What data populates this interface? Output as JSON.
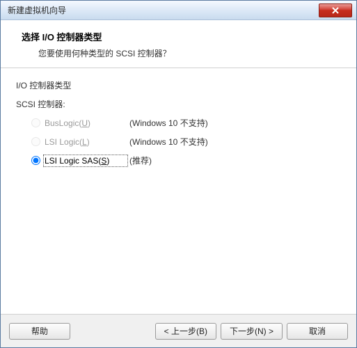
{
  "window": {
    "title": "新建虚拟机向导"
  },
  "header": {
    "title": "选择 I/O 控制器类型",
    "subtitle": "您要使用何种类型的 SCSI 控制器？"
  },
  "content": {
    "section_label": "I/O 控制器类型",
    "subsection_label": "SCSI 控制器:",
    "options": [
      {
        "label": "BusLogic(",
        "key": "U",
        "suffix": ")",
        "note": "(Windows 10 不支持)",
        "enabled": false,
        "selected": false
      },
      {
        "label": "LSI Logic(",
        "key": "L",
        "suffix": ")",
        "note": "(Windows 10 不支持)",
        "enabled": false,
        "selected": false
      },
      {
        "label": "LSI Logic SAS(",
        "key": "S",
        "suffix": ")",
        "note": "(推荐)",
        "enabled": true,
        "selected": true
      }
    ]
  },
  "footer": {
    "help": "帮助",
    "back": "< 上一步(B)",
    "next": "下一步(N) >",
    "cancel": "取消"
  }
}
